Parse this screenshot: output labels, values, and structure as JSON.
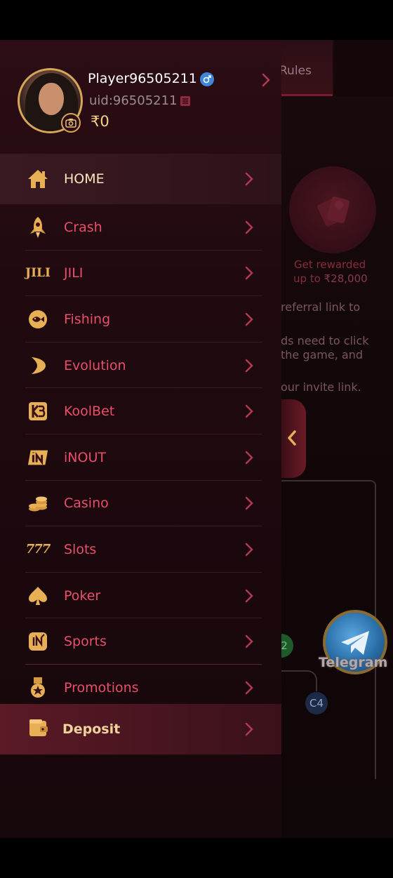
{
  "background": {
    "tab_label": "Rules",
    "reward_line1": "Get rewarded",
    "reward_line2_prefix": "up to ",
    "reward_amount": "₹28,000",
    "text1": "referral link to",
    "text2": "ds need to click",
    "text3": "the game, and",
    "text4": "our invite link.",
    "node_c2": "2",
    "node_c4": "C4",
    "telegram_label": "Telegram"
  },
  "profile": {
    "name": "Player96505211",
    "uid": "uid:96505211",
    "balance": "₹0",
    "gender_icon": "male-icon"
  },
  "menu": {
    "items": [
      {
        "label": "HOME",
        "icon": "home-icon"
      },
      {
        "label": "Crash",
        "icon": "rocket-icon"
      },
      {
        "label": "JILI",
        "icon": "jili-logo-icon"
      },
      {
        "label": "Fishing",
        "icon": "fish-icon"
      },
      {
        "label": "Evolution",
        "icon": "evolution-icon"
      },
      {
        "label": "KoolBet",
        "icon": "koolbet-icon"
      },
      {
        "label": "iNOUT",
        "icon": "inout-icon"
      },
      {
        "label": "Casino",
        "icon": "chips-icon"
      },
      {
        "label": "Slots",
        "icon": "slots-777-icon"
      },
      {
        "label": "Poker",
        "icon": "spade-icon"
      },
      {
        "label": "Sports",
        "icon": "sports-icon"
      },
      {
        "label": "Promotions",
        "icon": "medal-icon"
      }
    ],
    "deposit_label": "Deposit",
    "jili_text": "JILI",
    "slots_text": "777"
  },
  "colors": {
    "accent_gold": "#e8b055",
    "menu_text": "#e94e6a",
    "drawer_bg": "#200a10"
  }
}
